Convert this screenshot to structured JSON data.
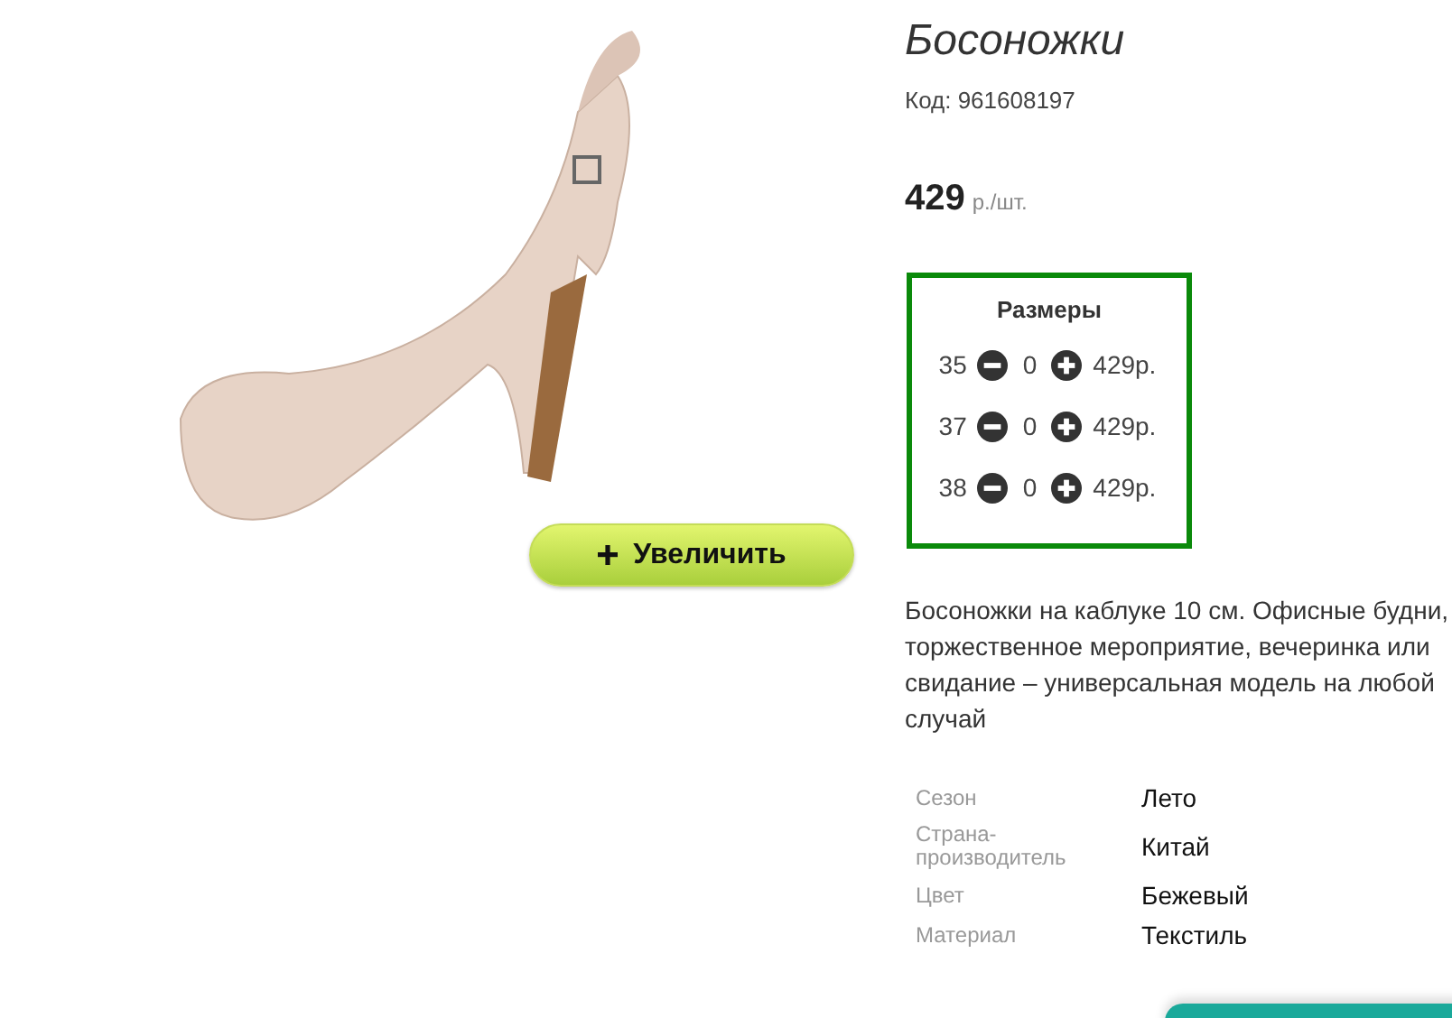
{
  "product": {
    "title": "Босоножки",
    "code": "Код: 961608197",
    "price": "429",
    "price_unit": "р./шт."
  },
  "zoom_button": {
    "label": "Увеличить"
  },
  "sizes": {
    "title": "Размеры",
    "rows": [
      {
        "size": "35",
        "quantity": "0",
        "price": "429р."
      },
      {
        "size": "37",
        "quantity": "0",
        "price": "429р."
      },
      {
        "size": "38",
        "quantity": "0",
        "price": "429р."
      }
    ]
  },
  "description": "Босоножки на каблуке 10 см. Офисные будни, торжественное мероприятие, вечеринка или свидание – универсальная модель на любой случай",
  "specs": [
    {
      "label": "Сезон",
      "value": "Лето"
    },
    {
      "label": "Страна-производитель",
      "value": "Китай"
    },
    {
      "label": "Цвет",
      "value": "Бежевый"
    },
    {
      "label": "Материал",
      "value": "Текстиль"
    }
  ]
}
